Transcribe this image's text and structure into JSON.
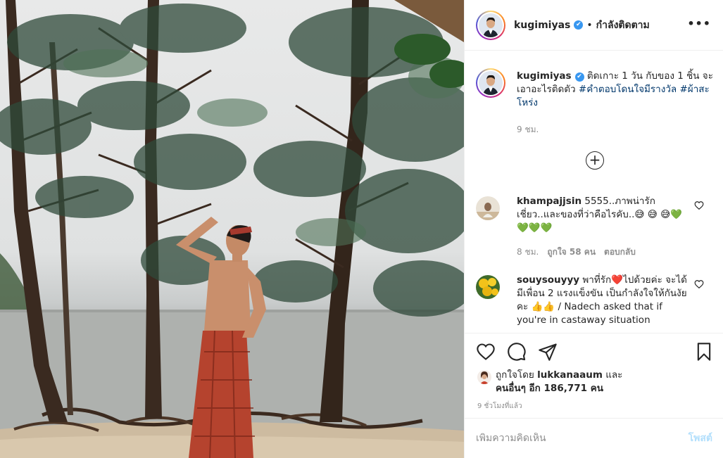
{
  "post": {
    "username": "kugimiyas",
    "verified_icon": "verified-badge-icon",
    "follow_state": "กำลังติดตาม",
    "separator": "•",
    "more_icon": "more-options-icon",
    "more_label": "•••"
  },
  "caption": {
    "username": "kugimiyas",
    "text": "ติดเกาะ 1 วัน กับของ 1 ชิ้น จะเอาอะไรติดตัว",
    "hashtag1": "#คำตอบโดนใจมีรางวัล",
    "hashtag2": "#ผ้าสะโหร่ง",
    "time": "9 ชม."
  },
  "load_more": {
    "label": "+",
    "icon": "plus-circle-icon"
  },
  "comments": [
    {
      "username": "khampajjsin",
      "text": "5555..ภาพน่ารัก เชี่ยว..และของที่ว่าคือไรคับ..😅 😅 😅💚💚💚💚",
      "time": "8 ชม.",
      "likes": "ถูกใจ 58 คน",
      "reply": "ตอบกลับ"
    },
    {
      "username": "souysouyyy",
      "text": "พาที่รัก❤️ไปด้วยค่ะ จะได้มีเพื่อน 2 แรงแข็งขัน เป็นกำลังใจให้กันงัยคะ 👍👍 / Nadech asked that if you're in castaway situation"
    }
  ],
  "actions": {
    "like_icon": "heart-icon",
    "comment_icon": "comment-icon",
    "share_icon": "share-icon",
    "save_icon": "bookmark-icon"
  },
  "likes": {
    "prefix": "ถูกใจโดย",
    "user": "lukkanaaum",
    "and": "และ",
    "others": "คนอื่นๆ อีก 186,771 คน"
  },
  "posted_time": "9 ชั่วโมงที่แล้ว",
  "add_comment": {
    "placeholder": "เพิ่มความคิดเห็น",
    "post_label": "โพสต์"
  }
}
